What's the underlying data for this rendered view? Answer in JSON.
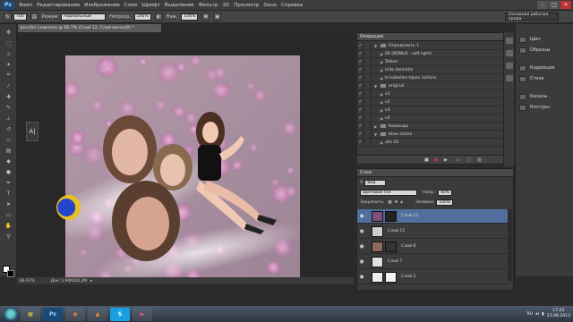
{
  "app": {
    "logo": "Ps"
  },
  "menu": [
    "Файл",
    "Редактирование",
    "Изображение",
    "Слои",
    "Шрифт",
    "Выделение",
    "Фильтр",
    "3D",
    "Просмотр",
    "Окно",
    "Справка"
  ],
  "window_buttons": {
    "minimize": "–",
    "maximize": "□",
    "close": "✕"
  },
  "options": {
    "brush_size": "700",
    "mode_label": "Режим:",
    "mode_value": "Нормальный",
    "opacity_label": "Непрозр.:",
    "opacity_value": "100%",
    "flow_label": "Наж.:",
    "flow_value": "100%",
    "workspace": "Основная рабочая среда"
  },
  "document": {
    "tab_title": "Jennifer Lawrence @ 66.7% (Слой 12, Слой-маска/8) *",
    "zoom": "66.67%",
    "doc_size": "Док: 1,90M/24,2M"
  },
  "char_panel": {
    "glyph": "A|"
  },
  "actions": {
    "title": "Операции",
    "rows": [
      {
        "label": "Определить 1",
        "type": "set",
        "expanded": true
      },
      {
        "label": "00 (BONUS - soft light)",
        "type": "action"
      },
      {
        "label": "Tattoo",
        "type": "action"
      },
      {
        "label": "mila damiatin",
        "type": "action"
      },
      {
        "label": "tr-isabelles topac actions",
        "type": "action"
      },
      {
        "label": "original",
        "type": "set",
        "expanded": true
      },
      {
        "label": "v1",
        "type": "action"
      },
      {
        "label": "v2",
        "type": "action"
      },
      {
        "label": "v3",
        "type": "action"
      },
      {
        "label": "v4",
        "type": "action"
      },
      {
        "label": "Команды",
        "type": "set"
      },
      {
        "label": "blow action",
        "type": "set",
        "expanded": true
      },
      {
        "label": "alin 01",
        "type": "action"
      }
    ]
  },
  "layers": {
    "title": "Слои",
    "filter_label": "Вид",
    "blend_mode": "Цветовой тон",
    "opacity_label": "Непр.:",
    "opacity_value": "80%",
    "lock_label": "Закрепить:",
    "fill_label": "Заливка:",
    "fill_value": "100%",
    "rows": [
      {
        "name": "Слой 12",
        "selected": true,
        "thumb": "#7d4f7a",
        "mask": "#222"
      },
      {
        "name": "Слой 11",
        "selected": false,
        "thumb": "#cfcfcf",
        "mask": ""
      },
      {
        "name": "Слой 8",
        "selected": false,
        "thumb": "#8a6a5a",
        "mask": "#333"
      },
      {
        "name": "Слой 7",
        "selected": false,
        "thumb": "#e0e0e0",
        "mask": ""
      },
      {
        "name": "Слой 2",
        "selected": false,
        "thumb": "#eeeeee",
        "mask": "#f4f4f4"
      }
    ]
  },
  "dock": [
    {
      "label": "Цвет"
    },
    {
      "label": "Образцы"
    },
    {
      "label": "Коррекция"
    },
    {
      "label": "Стили"
    },
    {
      "label": "Каналы"
    },
    {
      "label": "Контуры"
    }
  ],
  "taskbar": {
    "apps": [
      "",
      "Ps",
      "",
      "",
      "S",
      ""
    ],
    "lang": "RU",
    "time": "17:25",
    "date": "23.08.2013"
  },
  "colors": {
    "accent": "#516f9c",
    "panel": "#3b3b3b"
  }
}
